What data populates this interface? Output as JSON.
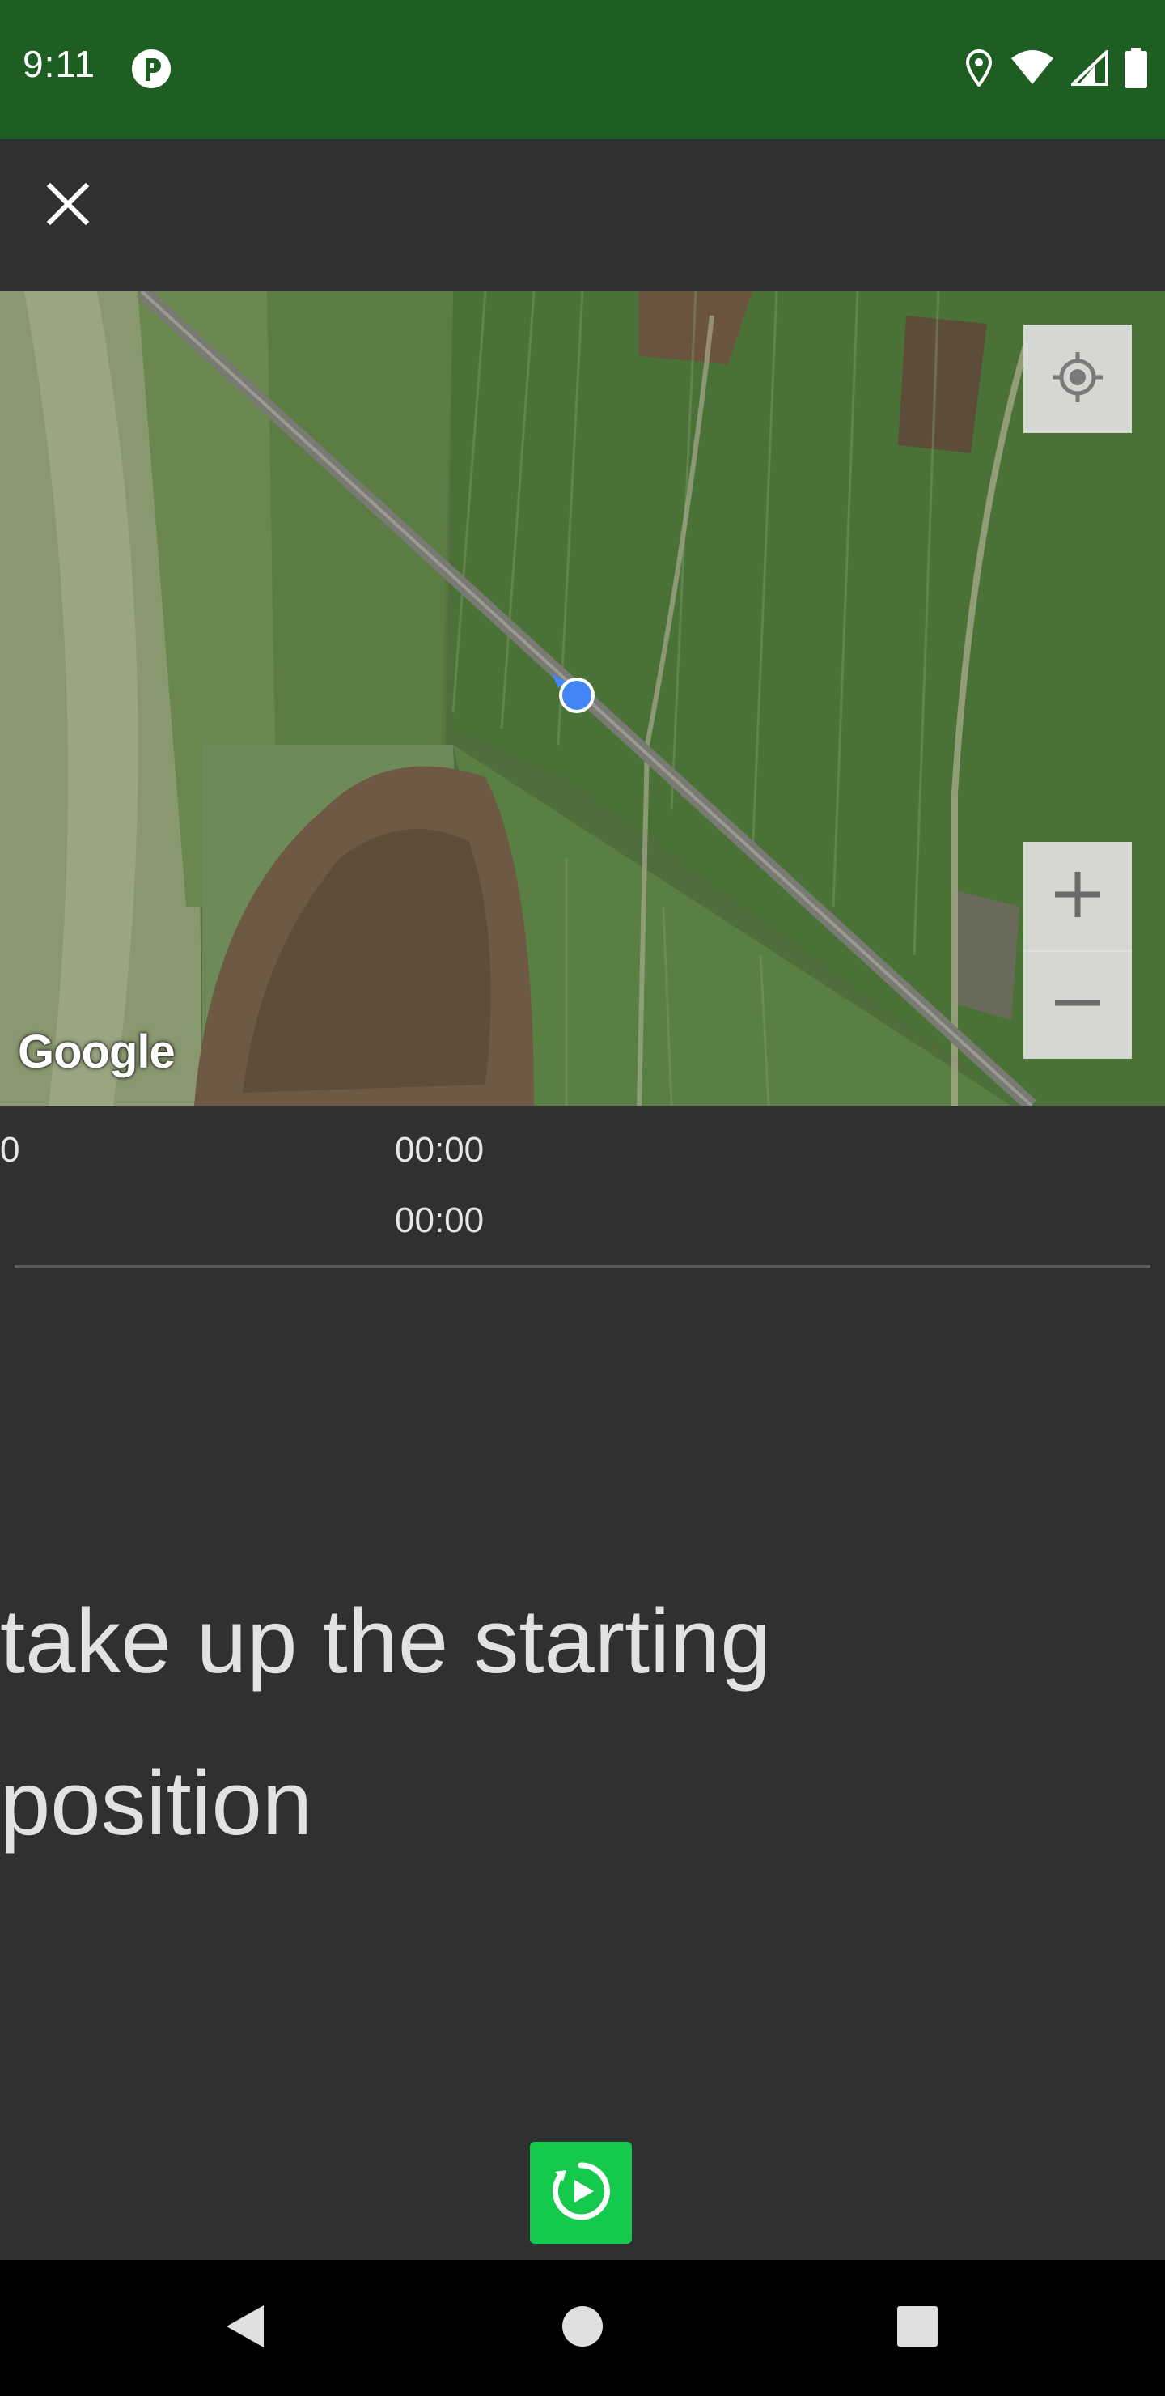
{
  "status_bar": {
    "time": "9:11",
    "icons": [
      "app-notification-icon",
      "location-icon",
      "wifi-icon",
      "cell-signal-icon",
      "battery-icon"
    ]
  },
  "toolbar": {
    "close_icon": "close-icon"
  },
  "map": {
    "attribution": "Google",
    "locate_icon": "my-location-icon",
    "zoom_in_icon": "plus-icon",
    "zoom_out_icon": "minus-icon"
  },
  "stats": {
    "distance": "0",
    "time_1": "00:00",
    "time_2": "00:00"
  },
  "instruction": {
    "line_1": "take up the starting",
    "line_2": "position"
  },
  "start_button": {
    "icon": "timer-play-icon"
  },
  "colors": {
    "status_bar": "#1f5e22",
    "background": "#303030",
    "accent": "#14c94b",
    "location_dot": "#4285f4"
  }
}
